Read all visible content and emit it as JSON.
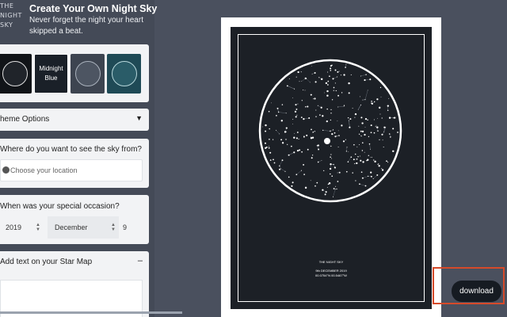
{
  "brand": {
    "lines": [
      "THE",
      "NIGHT",
      "SKY"
    ]
  },
  "header": {
    "title": "Create Your Own Night Sky",
    "subtitle": "Never forget the night your heart skipped a beat."
  },
  "themes": {
    "items": [
      {
        "id": "theme-black",
        "label": ""
      },
      {
        "id": "theme-midnight-blue",
        "label": "Midnight Blue",
        "selected": true
      },
      {
        "id": "theme-grey",
        "label": ""
      },
      {
        "id": "theme-teal",
        "label": ""
      }
    ]
  },
  "theme_options": {
    "label": "heme Options",
    "arrow": "▼"
  },
  "location": {
    "question": "Where do you want to see the sky from?",
    "placeholder": "Choose your location",
    "icon": "globe-icon"
  },
  "occasion": {
    "question": "When was your special occasion?",
    "year": "2019",
    "month": "December",
    "day": "9"
  },
  "star_text": {
    "question": "Add text on your Star Map",
    "toggle": "–"
  },
  "poster": {
    "line1": "THE NIGHT SKY",
    "line2": "9th DECEMBER 2019",
    "line3": "00.0754°N 00.5467°W"
  },
  "download": {
    "label": "download"
  },
  "colors": {
    "page_bg": "#4a505e",
    "panel_bg": "#444a57",
    "card_bg": "#f2f3f5",
    "poster_bg": "#1c2026",
    "highlight": "#d64a2a"
  }
}
